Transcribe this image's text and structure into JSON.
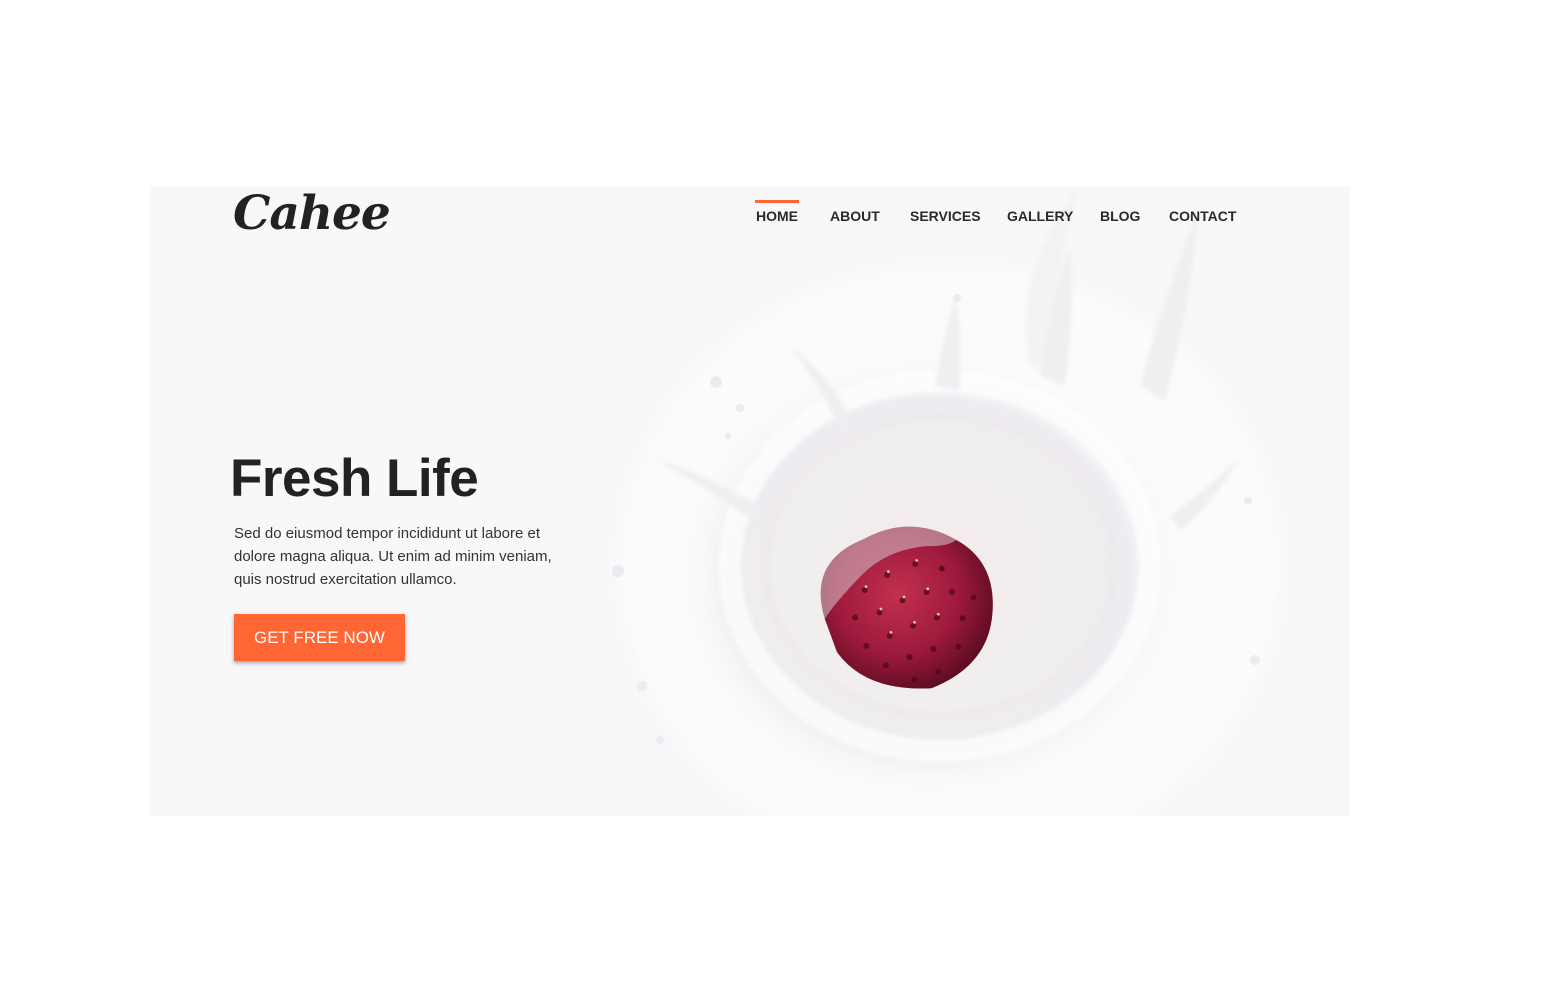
{
  "brand": {
    "logo_text": "Cahee"
  },
  "nav": {
    "items": [
      {
        "label": "HOME",
        "active": true
      },
      {
        "label": "ABOUT",
        "active": false
      },
      {
        "label": "SERVICES",
        "active": false
      },
      {
        "label": "GALLERY",
        "active": false
      },
      {
        "label": "BLOG",
        "active": false
      },
      {
        "label": "CONTACT",
        "active": false
      }
    ]
  },
  "hero": {
    "title": "Fresh Life",
    "text": "Sed do eiusmod tempor incididunt ut labore et dolore magna aliqua. Ut enim ad minim veniam, quis nostrud exercitation ullamco.",
    "cta_label": "GET FREE NOW",
    "image": "milk-splash-strawberry"
  },
  "colors": {
    "accent": "#ff6633",
    "text_dark": "#222222",
    "background": "#f8f7f9",
    "strawberry": "#9e1a3c"
  }
}
